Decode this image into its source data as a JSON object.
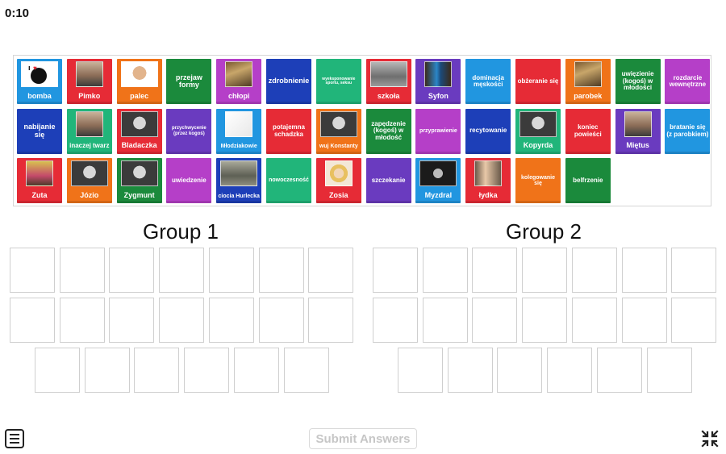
{
  "timer": "0:10",
  "groups": [
    "Group 1",
    "Group 2"
  ],
  "submit_label": "Submit Answers",
  "tiles": [
    {
      "label": "bomba",
      "color": "#2196e0",
      "img": "bomba-logo",
      "size": 9
    },
    {
      "label": "Pimko",
      "color": "#e62b36",
      "img": "portrait",
      "size": 9
    },
    {
      "label": "palec",
      "color": "#f07319",
      "img": "portrait-white",
      "size": 9
    },
    {
      "label": "przejaw formy",
      "color": "#1b8a3c",
      "img": null,
      "size": 9
    },
    {
      "label": "chłopi",
      "color": "#b53fc8",
      "img": "painting",
      "size": 9
    },
    {
      "label": "zdrobnienie",
      "color": "#1d3fb8",
      "img": null,
      "size": 9
    },
    {
      "label": "wyeksponowanie sportu, seksu",
      "color": "#21b57a",
      "img": null,
      "size": 5
    },
    {
      "label": "szkoła",
      "color": "#e62b36",
      "img": "building",
      "size": 9
    },
    {
      "label": "Syfon",
      "color": "#6a3bbf",
      "img": "bottle",
      "size": 9
    },
    {
      "label": "dominacja męskości",
      "color": "#2196e0",
      "img": null,
      "size": 8
    },
    {
      "label": "obżeranie się",
      "color": "#e62b36",
      "img": null,
      "size": 8
    },
    {
      "label": "parobek",
      "color": "#f07319",
      "img": "painting",
      "size": 9
    },
    {
      "label": "uwięzienie (kogoś) w młodości",
      "color": "#1b8a3c",
      "img": null,
      "size": 8
    },
    {
      "label": "rozdarcie wewnętrzne",
      "color": "#b53fc8",
      "img": null,
      "size": 8
    },
    {
      "label": "nabijanie się",
      "color": "#1d3fb8",
      "img": null,
      "size": 9
    },
    {
      "label": "inaczej twarz",
      "color": "#21b57a",
      "img": "portrait",
      "size": 8
    },
    {
      "label": "Bladaczka",
      "color": "#e62b36",
      "img": "portrait-bw",
      "size": 9
    },
    {
      "label": "przychwycenie (przez kogoś)",
      "color": "#6a3bbf",
      "img": null,
      "size": 6
    },
    {
      "label": "Młodziakowie",
      "color": "#2196e0",
      "img": "drawing",
      "size": 7
    },
    {
      "label": "potajemna schadzka",
      "color": "#e62b36",
      "img": null,
      "size": 8
    },
    {
      "label": "wuj Konstanty",
      "color": "#f07319",
      "img": "portrait-bw",
      "size": 7
    },
    {
      "label": "zapędzenie (kogoś) w młodość",
      "color": "#1b8a3c",
      "img": null,
      "size": 8
    },
    {
      "label": "przyprawienie",
      "color": "#b53fc8",
      "img": null,
      "size": 7
    },
    {
      "label": "recytowanie",
      "color": "#1d3fb8",
      "img": null,
      "size": 8
    },
    {
      "label": "Kopyrda",
      "color": "#21b57a",
      "img": "portrait-bw",
      "size": 9
    },
    {
      "label": "koniec powieści",
      "color": "#e62b36",
      "img": null,
      "size": 8
    },
    {
      "label": "Miętus",
      "color": "#6a3bbf",
      "img": "portrait",
      "size": 9
    },
    {
      "label": "bratanie się (z parobkiem)",
      "color": "#2196e0",
      "img": null,
      "size": 8
    },
    {
      "label": "Zuta",
      "color": "#e62b36",
      "img": "portrait-color",
      "size": 9
    },
    {
      "label": "Józio",
      "color": "#f07319",
      "img": "portrait-bw",
      "size": 9
    },
    {
      "label": "Zygmunt",
      "color": "#1b8a3c",
      "img": "portrait-bw",
      "size": 9
    },
    {
      "label": "uwiedzenie",
      "color": "#b53fc8",
      "img": null,
      "size": 8
    },
    {
      "label": "ciocia Hurlecka",
      "color": "#1d3fb8",
      "img": "painting-bw",
      "size": 7
    },
    {
      "label": "nowoczesność",
      "color": "#21b57a",
      "img": null,
      "size": 7
    },
    {
      "label": "Zosia",
      "color": "#e62b36",
      "img": "portrait-blonde",
      "size": 9
    },
    {
      "label": "szczekanie",
      "color": "#6a3bbf",
      "img": null,
      "size": 8
    },
    {
      "label": "Myzdral",
      "color": "#2196e0",
      "img": "portrait-dark",
      "size": 9
    },
    {
      "label": "łydka",
      "color": "#e62b36",
      "img": "legs",
      "size": 9
    },
    {
      "label": "kolegowanie się",
      "color": "#f07319",
      "img": null,
      "size": 7
    },
    {
      "label": "belfrzenie",
      "color": "#1b8a3c",
      "img": null,
      "size": 8
    }
  ]
}
